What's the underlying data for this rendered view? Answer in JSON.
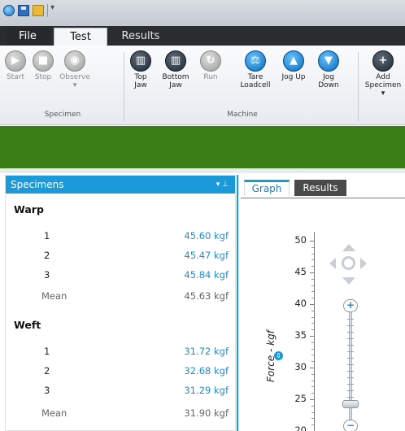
{
  "quick_access": {
    "icons": [
      "app-orb-icon",
      "save-icon",
      "open-folder-icon",
      "customize-icon"
    ]
  },
  "tabs": {
    "file": "File",
    "test": "Test",
    "results": "Results"
  },
  "ribbon": {
    "specimen_group": {
      "label": "Specimen",
      "start": "Start",
      "stop": "Stop",
      "observe": "Observe"
    },
    "machine_group": {
      "label": "Machine",
      "top_jaw": "Top Jaw",
      "bottom_jaw": "Bottom Jaw",
      "run": "Run",
      "tare_loadcell": "Tare Loadcell",
      "jog_up": "Jog Up",
      "jog_down": "Jog Down"
    },
    "add_specimen": "Add Specimen"
  },
  "accent_colors": {
    "header_blue": "#1a9ad8",
    "status_green": "#3a7d14"
  },
  "specimens_panel": {
    "title": "Specimens",
    "groups": [
      {
        "name": "Warp",
        "rows": [
          {
            "id": "1",
            "value": "45.60 kgf"
          },
          {
            "id": "2",
            "value": "45.47 kgf"
          },
          {
            "id": "3",
            "value": "45.84 kgf"
          }
        ],
        "mean_label": "Mean",
        "mean_value": "45.63 kgf"
      },
      {
        "name": "Weft",
        "rows": [
          {
            "id": "1",
            "value": "31.72 kgf"
          },
          {
            "id": "2",
            "value": "32.68 kgf"
          },
          {
            "id": "3",
            "value": "31.29 kgf"
          }
        ],
        "mean_label": "Mean",
        "mean_value": "31.90 kgf"
      }
    ]
  },
  "graph_tabs": {
    "graph": "Graph",
    "results": "Results"
  },
  "graph": {
    "y_axis_title": "Force - kgf",
    "y_ticks": [
      "50",
      "45",
      "40",
      "35",
      "30",
      "25",
      "20"
    ]
  }
}
